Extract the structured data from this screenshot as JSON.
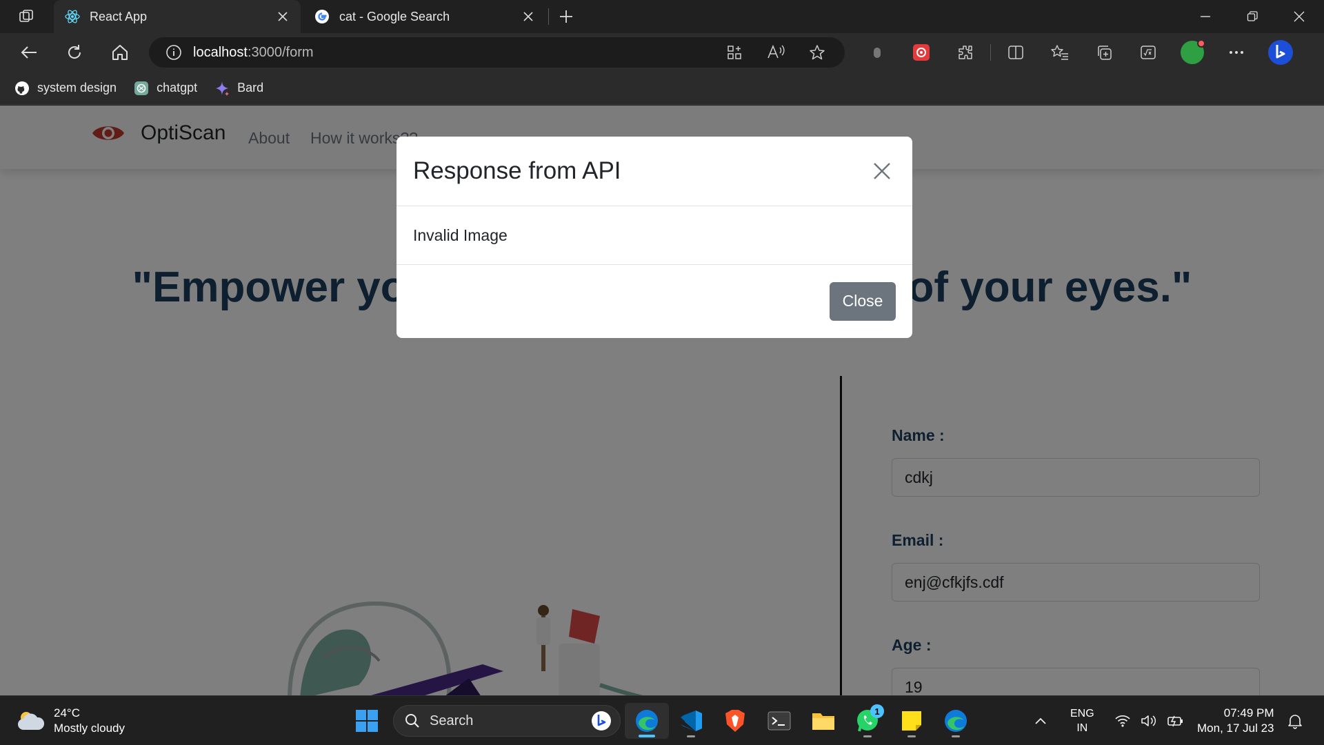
{
  "browser": {
    "tabs": [
      {
        "title": "React App",
        "active": true
      },
      {
        "title": "cat - Google Search",
        "active": false
      }
    ],
    "address": {
      "host": "localhost",
      "path": ":3000/form"
    },
    "bookmarks": [
      {
        "label": "system design",
        "icon": "github-icon"
      },
      {
        "label": "chatgpt",
        "icon": "chatgpt-icon"
      },
      {
        "label": "Bard",
        "icon": "bard-icon"
      }
    ]
  },
  "site": {
    "brand": "OptiScan",
    "nav": [
      "About",
      "How it works??"
    ],
    "hero": "\"Empower your vision with the health of your eyes.\""
  },
  "form": {
    "fields": [
      {
        "label": "Name :",
        "value": "cdkj"
      },
      {
        "label": "Email :",
        "value": "enj@cfkjfs.cdf"
      },
      {
        "label": "Age :",
        "value": "19"
      }
    ]
  },
  "modal": {
    "title": "Response from API",
    "body": "Invalid Image",
    "close_label": "Close"
  },
  "taskbar": {
    "weather": {
      "temp": "24°C",
      "condition": "Mostly cloudy"
    },
    "search_label": "Search",
    "whatsapp_badge": "1",
    "lang": {
      "line1": "ENG",
      "line2": "IN"
    },
    "clock": {
      "time": "07:49 PM",
      "date": "Mon, 17 Jul 23"
    }
  },
  "colors": {
    "hero_text": "#1d3f5e",
    "modal_button": "#6c757d",
    "accent": "#4cc2ff"
  }
}
